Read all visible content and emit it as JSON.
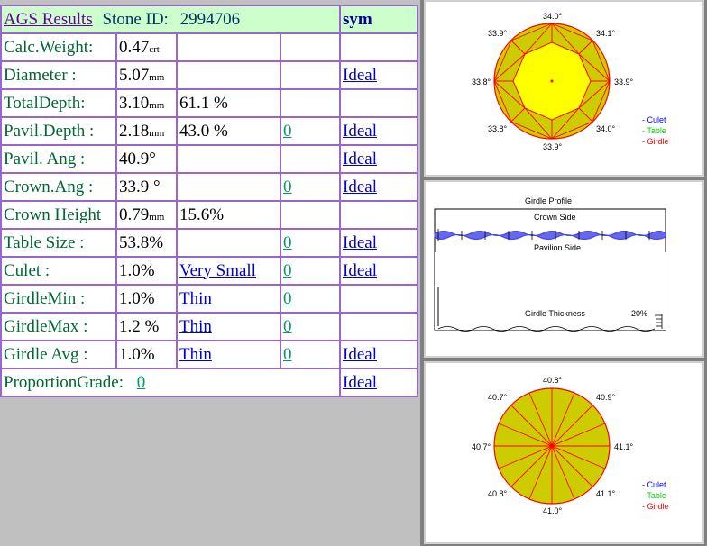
{
  "header": {
    "title": "AGS  Results",
    "stone_label": "Stone ID:",
    "stone_id": "2994706",
    "sym": "sym"
  },
  "rows": [
    {
      "label": "Calc.Weight:",
      "value": "0.47",
      "unit": "crt",
      "pct": "",
      "grade": "",
      "flag": "",
      "sym": ""
    },
    {
      "label": "Diameter :",
      "value": "5.07",
      "unit": "mm",
      "pct": "",
      "grade": "",
      "flag": "",
      "sym": "Ideal"
    },
    {
      "label": "TotalDepth:",
      "value": "3.10",
      "unit": "mm",
      "pct": "61.1 %",
      "grade": "",
      "flag": "",
      "sym": ""
    },
    {
      "label": "Pavil.Depth :",
      "value": "2.18",
      "unit": "mm",
      "pct": "43.0 %",
      "grade": "",
      "flag": "0",
      "sym": "Ideal"
    },
    {
      "label": "Pavil. Ang :",
      "value": "40.9°",
      "unit": "",
      "pct": "",
      "grade": "",
      "flag": "",
      "sym": "Ideal "
    },
    {
      "label": "Crown.Ang :",
      "value": "33.9 °",
      "unit": "",
      "pct": "",
      "grade": "",
      "flag": "0",
      "sym": "Ideal"
    },
    {
      "label": "Crown Height",
      "value": "0.79",
      "unit": "mm",
      "pct": "15.6%",
      "grade": "",
      "flag": "",
      "sym": ""
    },
    {
      "label": "Table Size :",
      "value": "53.8%",
      "unit": "",
      "pct": "",
      "grade": "",
      "flag": "0",
      "sym": "Ideal"
    },
    {
      "label": "Culet :",
      "value": "1.0%",
      "unit": "",
      "pct": "",
      "grade": "Very Small",
      "flag": "0",
      "sym": "Ideal"
    },
    {
      "label": "GirdleMin :",
      "value": "1.0%",
      "unit": "",
      "pct": "",
      "grade": "Thin",
      "flag": "0",
      "sym": ""
    },
    {
      "label": "GirdleMax :",
      "value": "1.2 %",
      "unit": "",
      "pct": "",
      "grade": "Thin ",
      "flag": "0",
      "sym": ""
    },
    {
      "label": "Girdle Avg :",
      "value": "1.0%",
      "unit": "",
      "pct": "",
      "grade": "Thin ",
      "flag": "0",
      "sym": "Ideal "
    }
  ],
  "proportion": {
    "label": "ProportionGrade:",
    "value": "0",
    "sym": "Ideal "
  },
  "crown_diagram": {
    "angles": {
      "top": "34.0°",
      "top_left": "33.9°",
      "top_right": "34.1°",
      "left": "33.8°",
      "right": "33.9°",
      "bottom_left": "33.8°",
      "bottom_right": "34.0°",
      "bottom": "33.9°"
    },
    "legend": {
      "culet": "- Culet",
      "table": "- Table",
      "girdle": "- Girdle"
    },
    "colors": {
      "culet": "#0000ff",
      "table": "#00cc00",
      "girdle": "#ff0000",
      "facet": "#cccc00",
      "table_fill": "#ffff00"
    }
  },
  "girdle_profile": {
    "title": "Girdle Profile",
    "crown_side": "Crown Side",
    "pavilion_side": "Pavilion Side",
    "thickness_label": "Girdle Thickness",
    "thickness_pct": "20%"
  },
  "pavilion_diagram": {
    "angles": {
      "top": "40.8°",
      "top_left": "40.7°",
      "top_right": "40.9°",
      "left": "40.7°",
      "right": "41.1°",
      "bottom_left": "40.8°",
      "bottom_right": "41.1°",
      "bottom": "41.0°"
    },
    "legend": {
      "culet": "- Culet",
      "table": "- Table",
      "girdle": "- Girdle"
    }
  }
}
